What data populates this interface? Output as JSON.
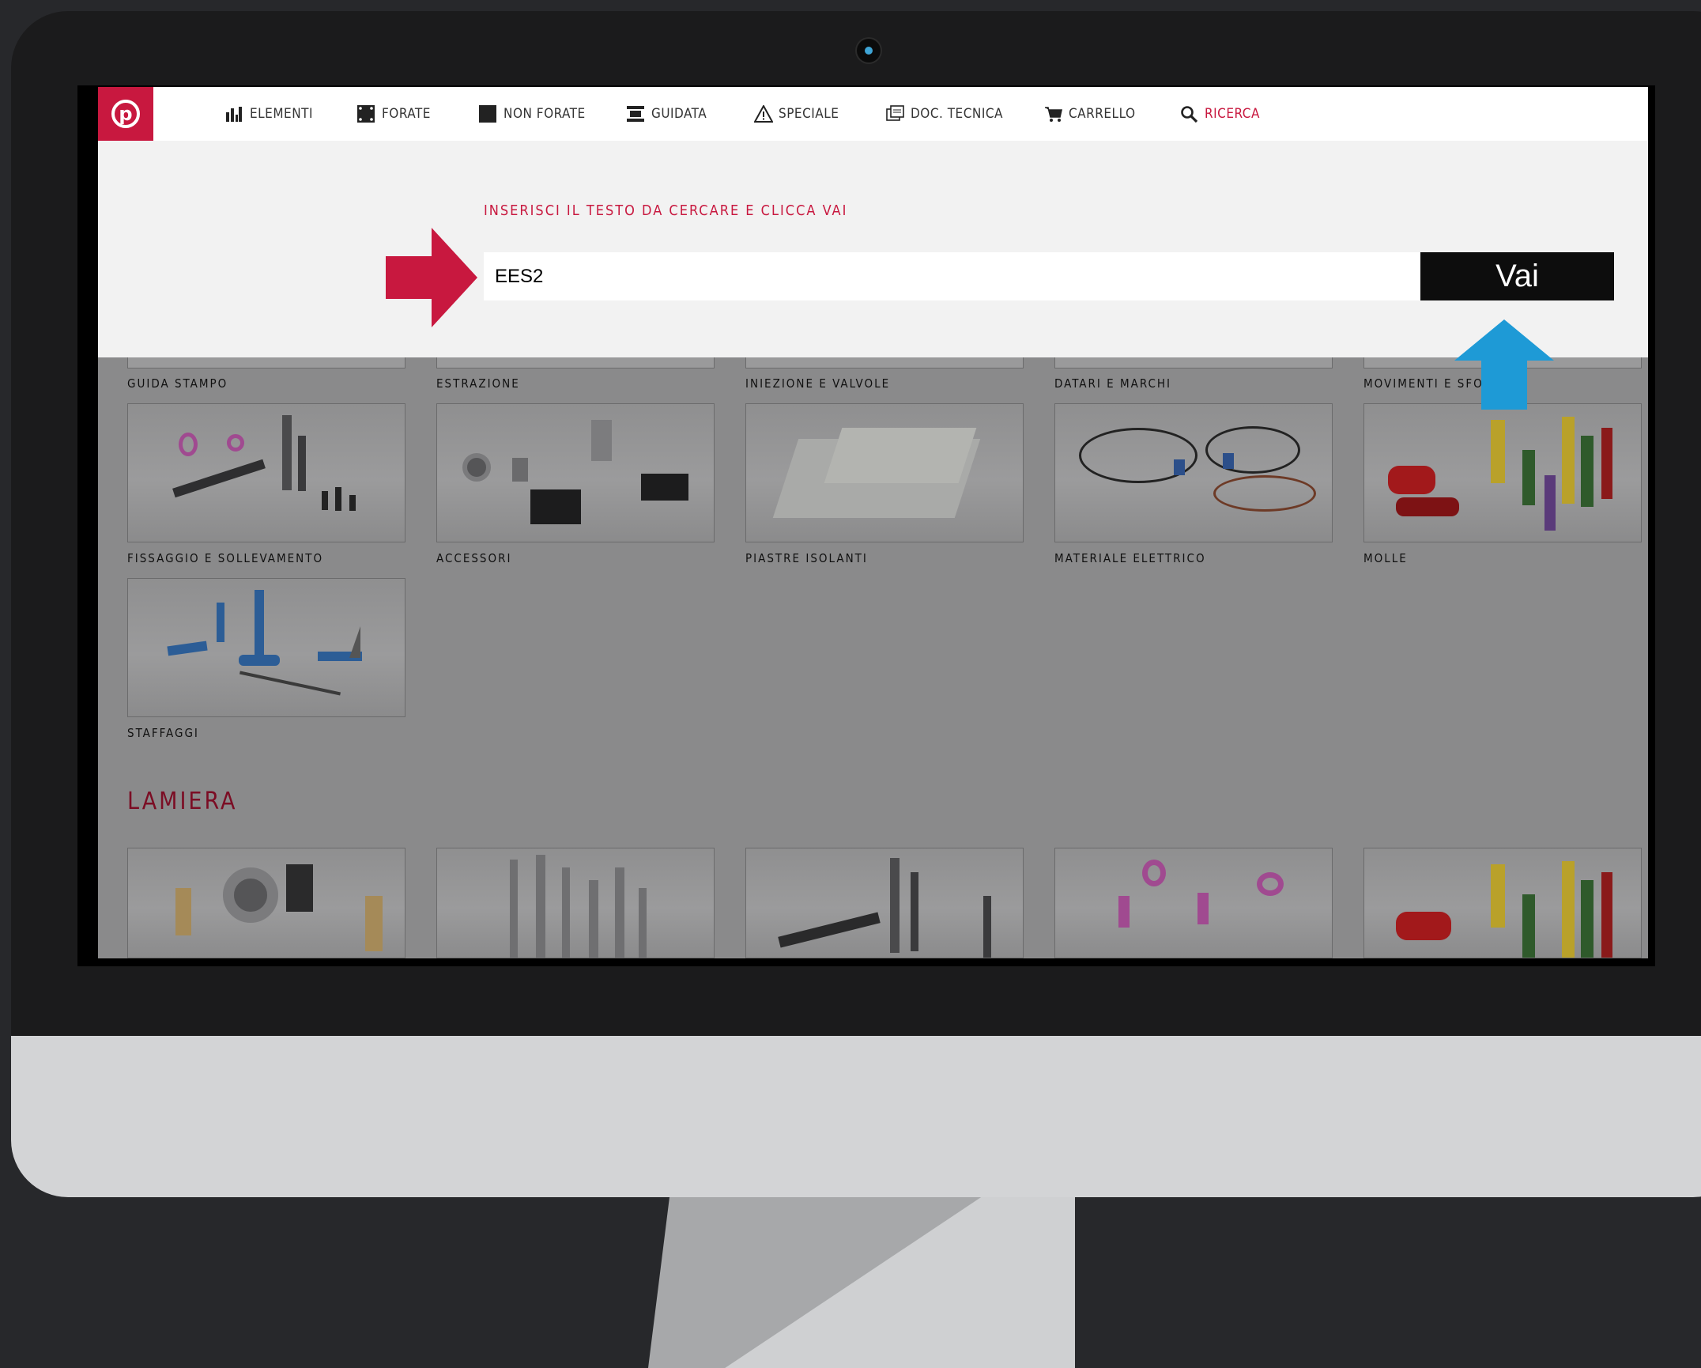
{
  "nav": {
    "logo_letter": "p",
    "items": [
      {
        "label": "ELEMENTI",
        "icon": "bar-chart-icon"
      },
      {
        "label": "FORATE",
        "icon": "perforated-square-icon"
      },
      {
        "label": "NON FORATE",
        "icon": "solid-square-icon"
      },
      {
        "label": "GUIDATA",
        "icon": "guided-plate-icon"
      },
      {
        "label": "SPECIALE",
        "icon": "warning-triangle-icon"
      },
      {
        "label": "DOC. TECNICA",
        "icon": "documents-icon"
      },
      {
        "label": "CARRELLO",
        "icon": "cart-icon"
      },
      {
        "label": "RICERCA",
        "icon": "search-icon"
      }
    ],
    "active": "RICERCA"
  },
  "search": {
    "hint": "INSERISCI IL TESTO DA CERCARE E CLICCA VAI",
    "value": "EES2",
    "button_label": "Vai"
  },
  "categories": {
    "top_row": [
      "GUIDA STAMPO",
      "ESTRAZIONE",
      "INIEZIONE E VALVOLE",
      "DATARI E MARCHI",
      "MOVIMENTI E SFOR"
    ],
    "middle_row": [
      "FISSAGGIO E SOLLEVAMENTO",
      "ACCESSORI",
      "PIASTRE ISOLANTI",
      "MATERIALE ELETTRICO",
      "MOLLE"
    ],
    "bottom_row": [
      "STAFFAGGI"
    ]
  },
  "section": {
    "title": "LAMIERA"
  },
  "colors": {
    "brand_red": "#c8183f",
    "arrow_blue": "#1e9ad6",
    "button_black": "#0d0d0d"
  }
}
